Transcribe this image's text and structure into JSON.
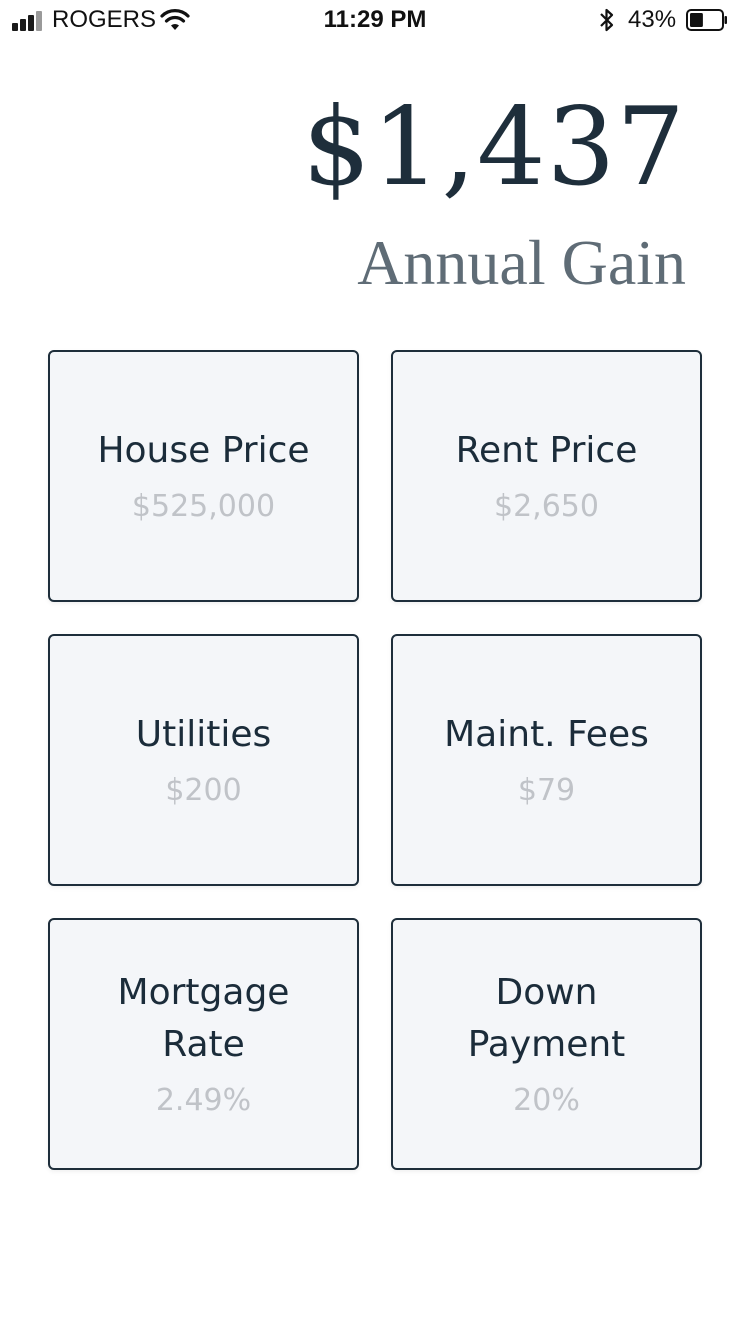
{
  "status_bar": {
    "carrier": "ROGERS",
    "time": "11:29 PM",
    "battery_percent": "43%",
    "battery_level": 0.43,
    "icons": [
      "signal-icon",
      "wifi-icon",
      "bluetooth-icon",
      "battery-icon"
    ]
  },
  "header": {
    "amount": "$1,437",
    "label": "Annual Gain"
  },
  "cards": [
    {
      "title": "House Price",
      "value": "$525,000"
    },
    {
      "title": "Rent Price",
      "value": "$2,650"
    },
    {
      "title": "Utilities",
      "value": "$200"
    },
    {
      "title": "Maint. Fees",
      "value": "$79"
    },
    {
      "title": "Mortgage\nRate",
      "value": "2.49%"
    },
    {
      "title": "Down\nPayment",
      "value": "20%"
    }
  ],
  "colors": {
    "text_dark": "#1e2e3b",
    "label_gray": "#5f6c76",
    "value_gray": "#c0c3c8",
    "card_bg": "#f4f6f9"
  }
}
